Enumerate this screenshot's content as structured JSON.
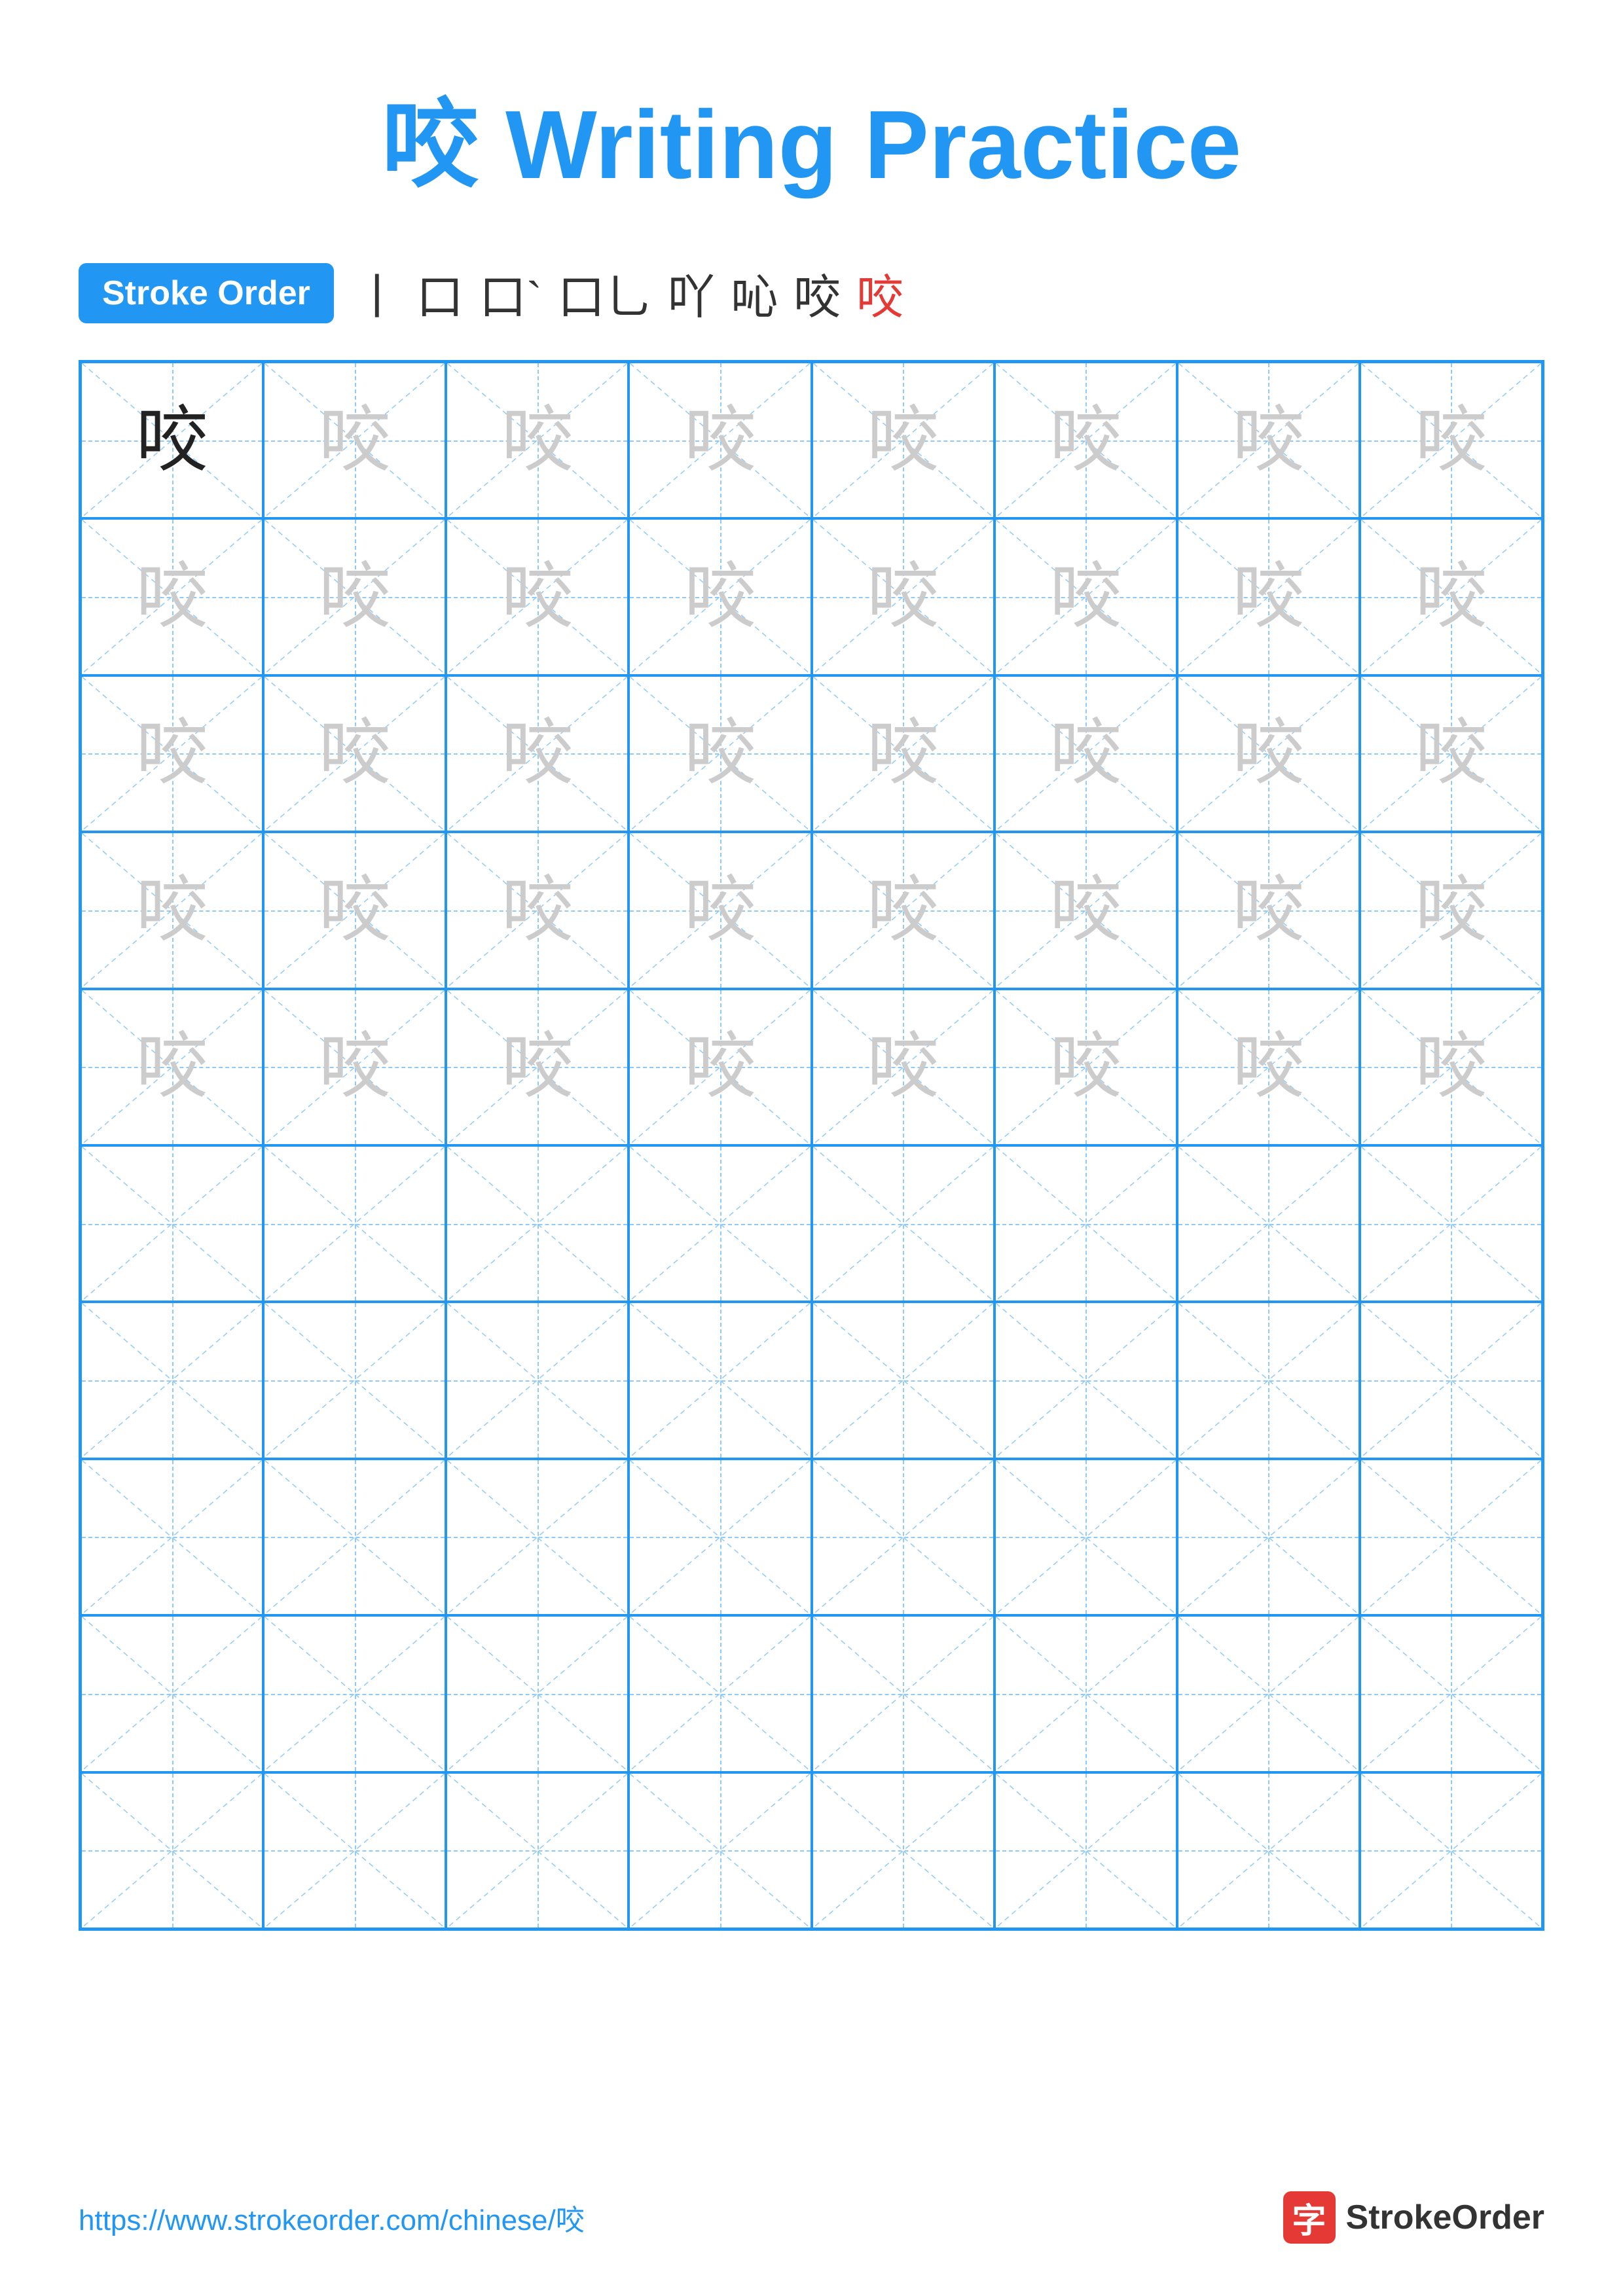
{
  "title": {
    "char": "咬",
    "text": "Writing Practice",
    "full": "咬 Writing Practice"
  },
  "stroke_order": {
    "badge_label": "Stroke Order",
    "chars": [
      "丨",
      "口",
      "口`",
      "口⺃",
      "吖",
      "吣",
      "咬",
      "咬"
    ]
  },
  "grid": {
    "rows": 10,
    "cols": 8,
    "practice_char": "咬",
    "filled_rows": 5,
    "empty_rows": 5
  },
  "footer": {
    "url": "https://www.strokeorder.com/chinese/咬",
    "logo_icon": "字",
    "logo_text": "StrokeOrder"
  }
}
